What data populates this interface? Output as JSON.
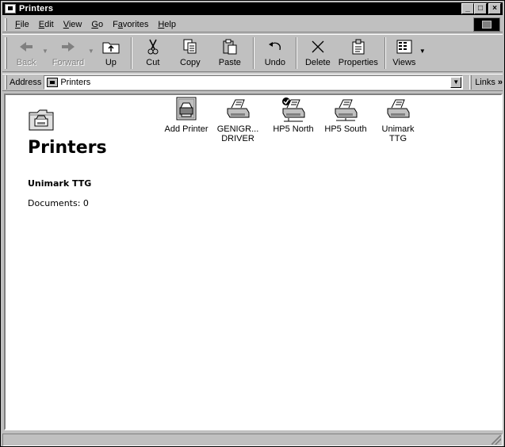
{
  "window": {
    "title": "Printers",
    "controls": [
      "minimize",
      "maximize",
      "close"
    ]
  },
  "menubar": {
    "items": [
      {
        "label": "File",
        "key": "F"
      },
      {
        "label": "Edit",
        "key": "E"
      },
      {
        "label": "View",
        "key": "V"
      },
      {
        "label": "Go",
        "key": "G"
      },
      {
        "label": "Favorites",
        "key": "a"
      },
      {
        "label": "Help",
        "key": "H"
      }
    ]
  },
  "toolbar": {
    "back": "Back",
    "forward": "Forward",
    "up": "Up",
    "cut": "Cut",
    "copy": "Copy",
    "paste": "Paste",
    "undo": "Undo",
    "delete": "Delete",
    "properties": "Properties",
    "views": "Views"
  },
  "address": {
    "label": "Address",
    "value": "Printers",
    "links": "Links"
  },
  "panel": {
    "title": "Printers",
    "selected_name": "Unimark TTG",
    "documents": "Documents: 0"
  },
  "printers": [
    {
      "label": "Add Printer",
      "icon": "add-printer-icon"
    },
    {
      "label": "GENIGR... DRIVER",
      "icon": "printer-icon"
    },
    {
      "label": "HP5 North",
      "icon": "default-printer-icon",
      "default": true
    },
    {
      "label": "HP5 South",
      "icon": "network-printer-icon"
    },
    {
      "label": "Unimark TTG",
      "icon": "printer-icon"
    }
  ],
  "colors": {
    "chrome": "#c0c0c0",
    "titlebar": "#000000",
    "content_bg": "#ffffff"
  }
}
